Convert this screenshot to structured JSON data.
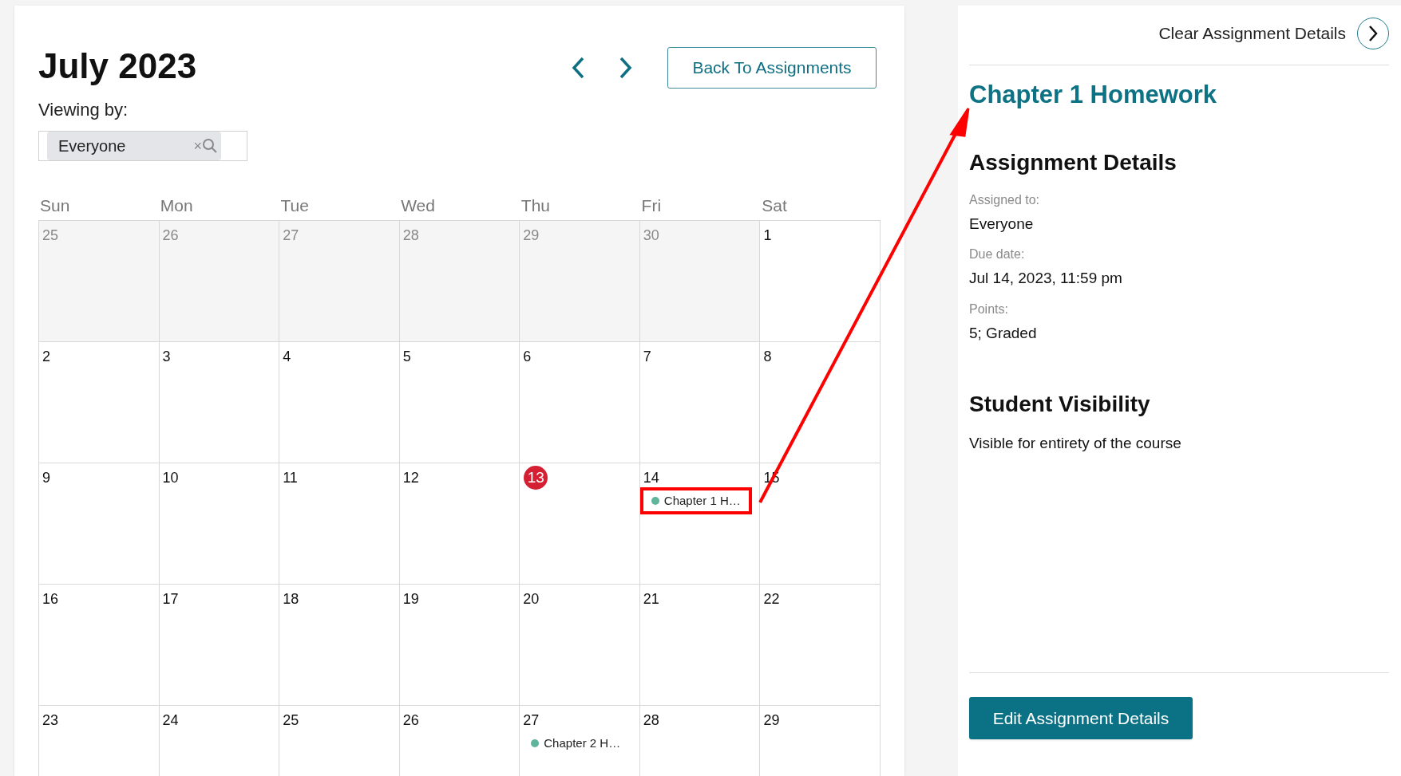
{
  "calendar": {
    "title": "July 2023",
    "back_button": "Back To Assignments",
    "viewing_by_label": "Viewing by:",
    "filter": {
      "value": "Everyone",
      "clear": "×"
    },
    "weekdays": [
      "Sun",
      "Mon",
      "Tue",
      "Wed",
      "Thu",
      "Fri",
      "Sat"
    ],
    "weeks": [
      [
        {
          "label": "25",
          "outside": true,
          "today": false
        },
        {
          "label": "26",
          "outside": true,
          "today": false
        },
        {
          "label": "27",
          "outside": true,
          "today": false
        },
        {
          "label": "28",
          "outside": true,
          "today": false
        },
        {
          "label": "29",
          "outside": true,
          "today": false
        },
        {
          "label": "30",
          "outside": true,
          "today": false
        },
        {
          "label": "1",
          "outside": false,
          "today": false
        }
      ],
      [
        {
          "label": "2",
          "outside": false,
          "today": false
        },
        {
          "label": "3",
          "outside": false,
          "today": false
        },
        {
          "label": "4",
          "outside": false,
          "today": false
        },
        {
          "label": "5",
          "outside": false,
          "today": false
        },
        {
          "label": "6",
          "outside": false,
          "today": false
        },
        {
          "label": "7",
          "outside": false,
          "today": false
        },
        {
          "label": "8",
          "outside": false,
          "today": false
        }
      ],
      [
        {
          "label": "9",
          "outside": false,
          "today": false
        },
        {
          "label": "10",
          "outside": false,
          "today": false
        },
        {
          "label": "11",
          "outside": false,
          "today": false
        },
        {
          "label": "12",
          "outside": false,
          "today": false
        },
        {
          "label": "13",
          "outside": false,
          "today": true
        },
        {
          "label": "14",
          "outside": false,
          "today": false,
          "events": [
            {
              "title": "Chapter 1 H…",
              "color": "#5fb49c",
              "highlighted": true
            }
          ]
        },
        {
          "label": "15",
          "outside": false,
          "today": false
        }
      ],
      [
        {
          "label": "16",
          "outside": false,
          "today": false
        },
        {
          "label": "17",
          "outside": false,
          "today": false
        },
        {
          "label": "18",
          "outside": false,
          "today": false
        },
        {
          "label": "19",
          "outside": false,
          "today": false
        },
        {
          "label": "20",
          "outside": false,
          "today": false
        },
        {
          "label": "21",
          "outside": false,
          "today": false
        },
        {
          "label": "22",
          "outside": false,
          "today": false
        }
      ],
      [
        {
          "label": "23",
          "outside": false,
          "today": false
        },
        {
          "label": "24",
          "outside": false,
          "today": false
        },
        {
          "label": "25",
          "outside": false,
          "today": false
        },
        {
          "label": "26",
          "outside": false,
          "today": false
        },
        {
          "label": "27",
          "outside": false,
          "today": false,
          "events": [
            {
              "title": "Chapter 2 H…",
              "color": "#5fb49c",
              "highlighted": false
            }
          ]
        },
        {
          "label": "28",
          "outside": false,
          "today": false
        },
        {
          "label": "29",
          "outside": false,
          "today": false
        }
      ]
    ]
  },
  "details": {
    "clear_link": "Clear Assignment Details",
    "title": "Chapter 1 Homework",
    "section_heading": "Assignment Details",
    "fields": [
      {
        "label": "Assigned to:",
        "value": "Everyone"
      },
      {
        "label": "Due date:",
        "value": "Jul 14, 2023, 11:59 pm"
      },
      {
        "label": "Points:",
        "value": "5; Graded"
      }
    ],
    "visibility_heading": "Student Visibility",
    "visibility_text": "Visible for entirety of the course",
    "edit_button": "Edit Assignment Details"
  }
}
